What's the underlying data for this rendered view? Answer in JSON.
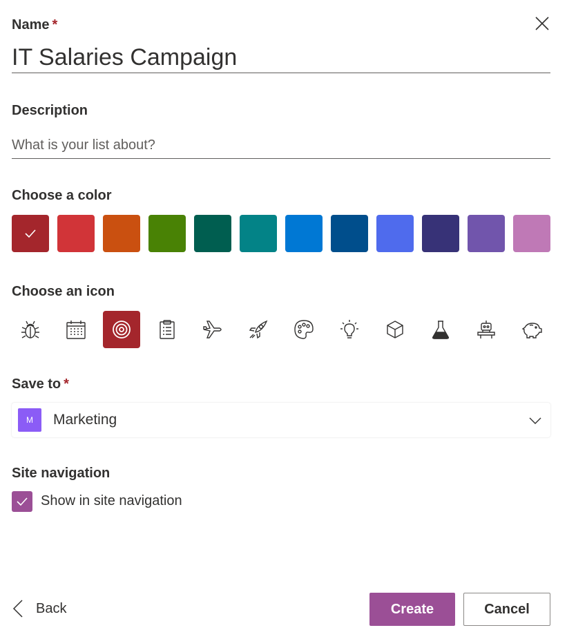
{
  "dialog": {
    "close_icon": "close-icon"
  },
  "name": {
    "label": "Name",
    "required_mark": "*",
    "value": "IT Salaries Campaign"
  },
  "description": {
    "label": "Description",
    "placeholder": "What is your list about?",
    "value": ""
  },
  "color": {
    "label": "Choose a color",
    "selected_index": 0,
    "options": [
      "#a4262c",
      "#d13438",
      "#ca5010",
      "#498205",
      "#005e50",
      "#038387",
      "#0078d4",
      "#004e8c",
      "#4f6bed",
      "#373277",
      "#7155ac",
      "#bf79b6"
    ]
  },
  "icon": {
    "label": "Choose an icon",
    "selected_index": 2,
    "options": [
      "bug-icon",
      "calendar-icon",
      "target-icon",
      "clipboard-icon",
      "airplane-icon",
      "rocket-icon",
      "palette-icon",
      "lightbulb-icon",
      "cube-icon",
      "flask-icon",
      "robot-icon",
      "piggy-bank-icon"
    ]
  },
  "save_to": {
    "label": "Save to",
    "required_mark": "*",
    "site_initial": "M",
    "site_name": "Marketing",
    "site_color": "#8b5cf6"
  },
  "site_navigation": {
    "label": "Site navigation",
    "checkbox_label": "Show in site navigation",
    "checked": true
  },
  "footer": {
    "back_label": "Back",
    "create_label": "Create",
    "cancel_label": "Cancel"
  },
  "theme": {
    "accent": "#9b4f96",
    "required": "#a4262c"
  }
}
